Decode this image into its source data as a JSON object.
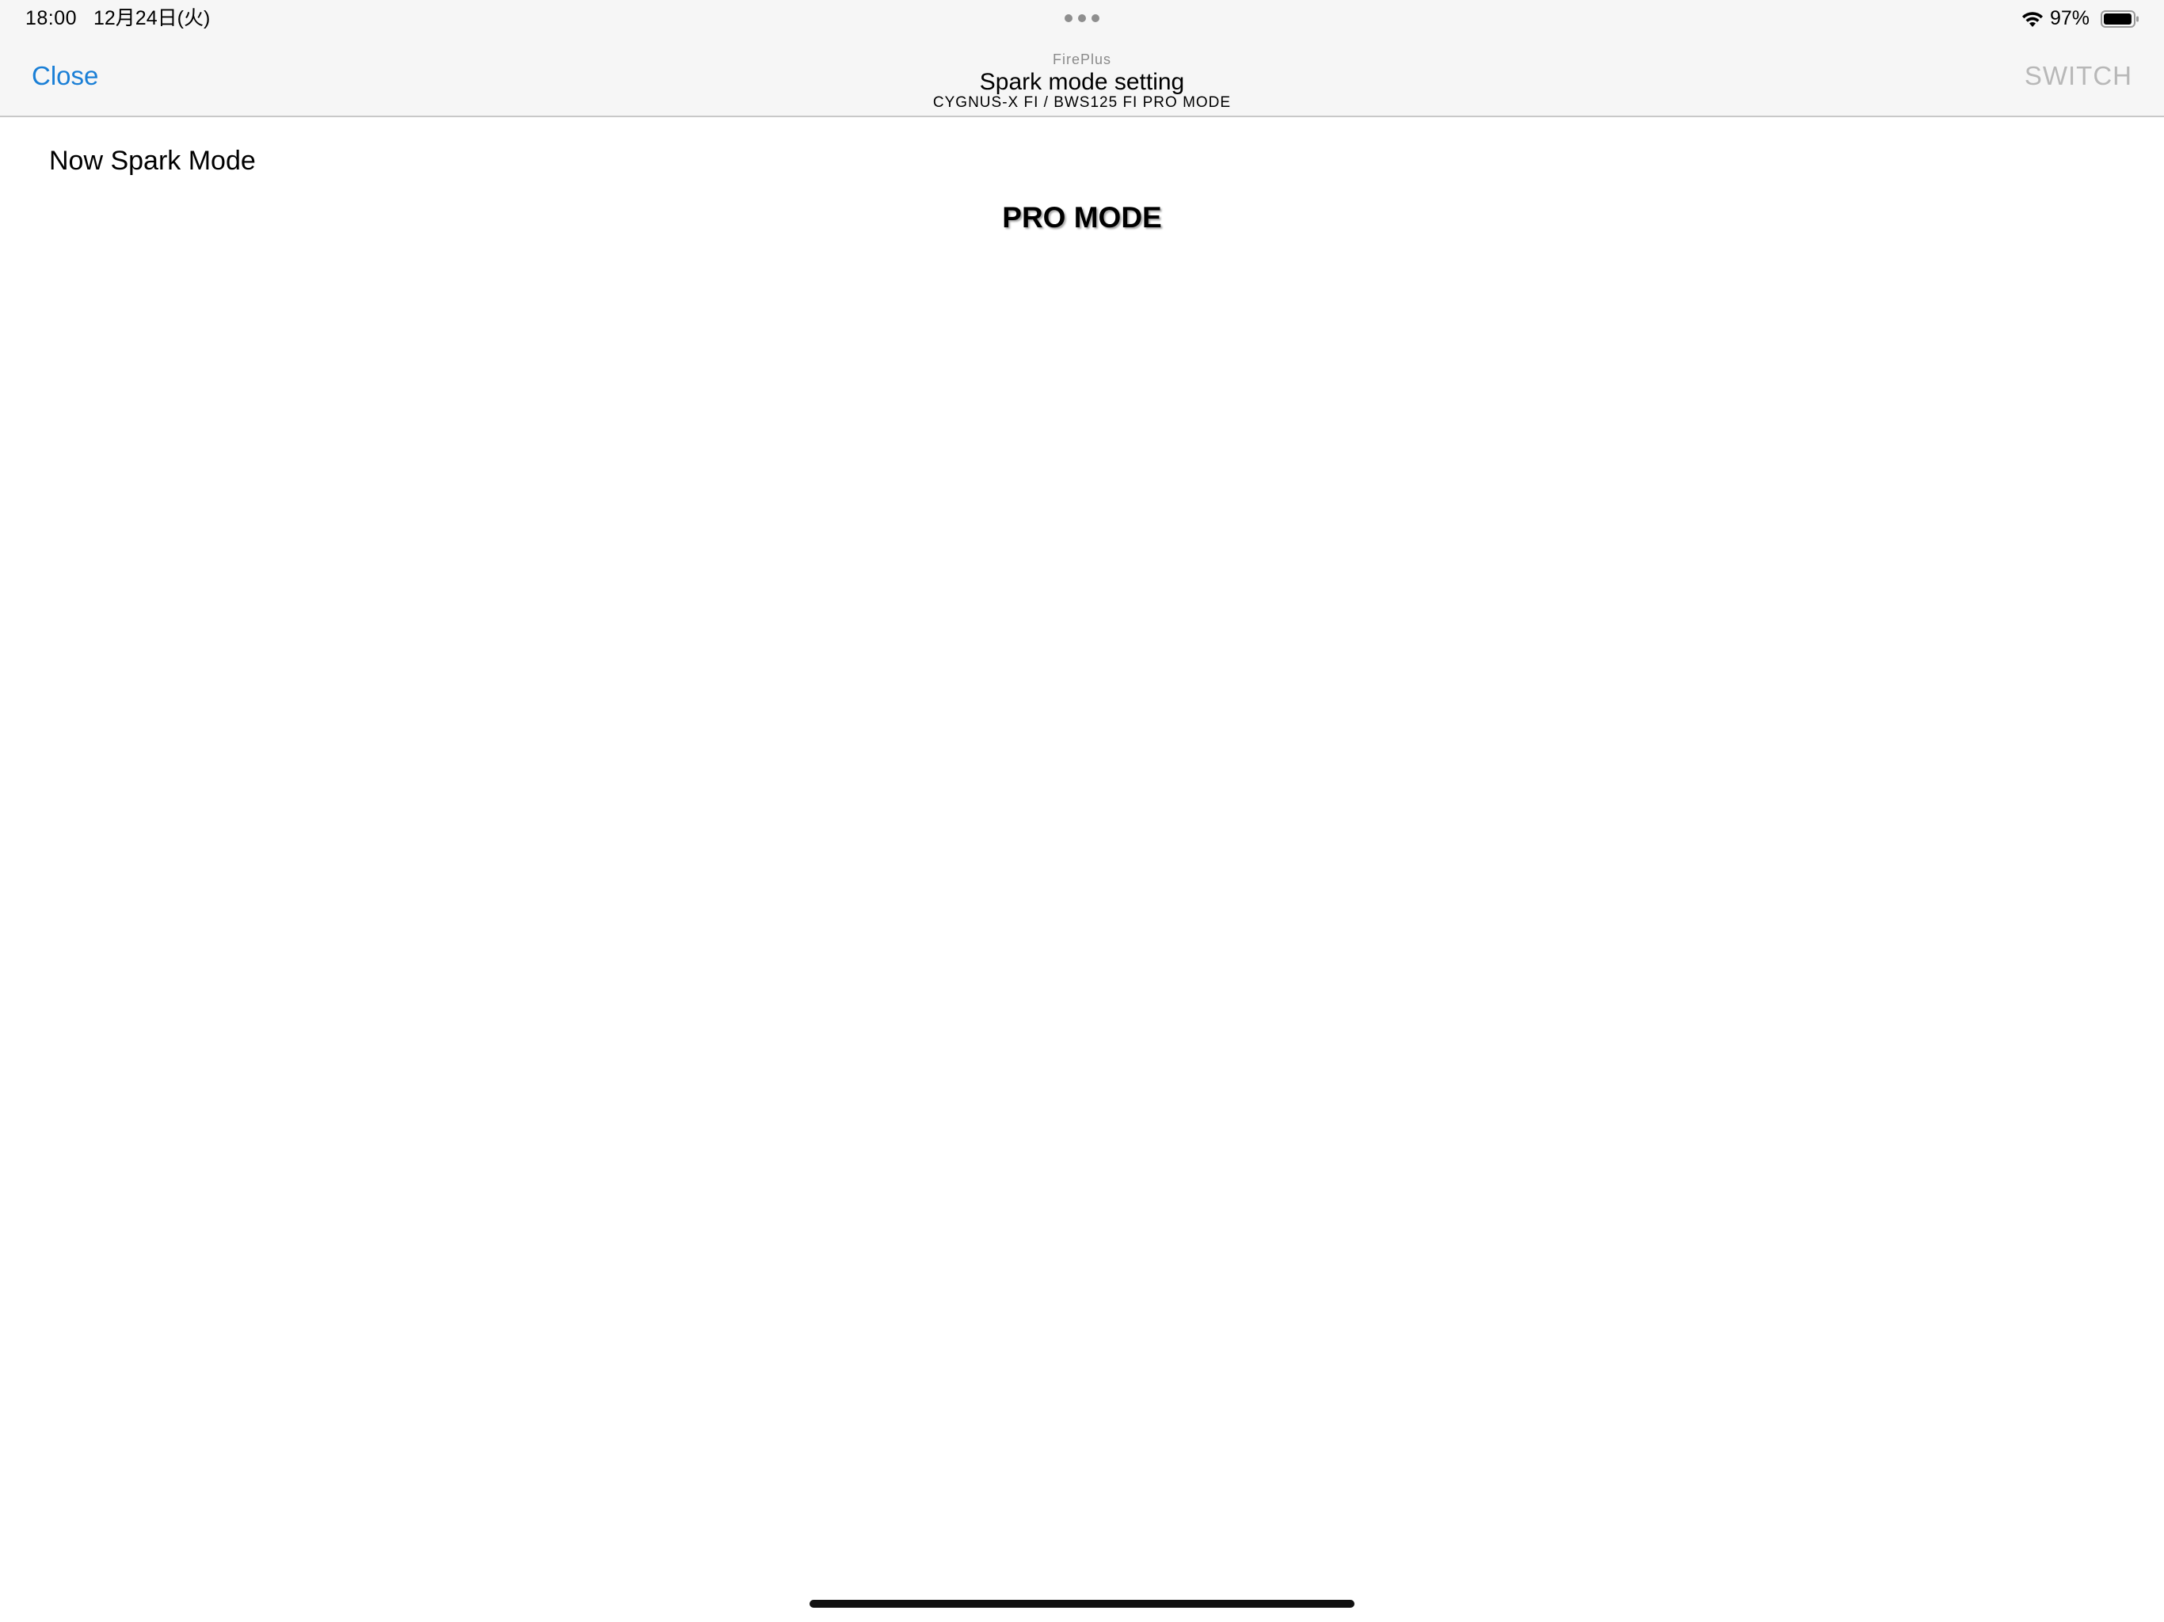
{
  "status_bar": {
    "time": "18:00",
    "date": "12月24日(火)",
    "battery_percent": "97%",
    "battery_level": 0.97
  },
  "nav": {
    "close_label": "Close",
    "app_name": "FirePlus",
    "title": "Spark mode setting",
    "subtitle": "CYGNUS-X FI / BWS125 FI PRO MODE",
    "switch_label": "SWITCH"
  },
  "content": {
    "now_label": "Now Spark Mode",
    "mode_value": "PRO MODE"
  },
  "colors": {
    "accent": "#1a7fd6",
    "disabled": "#b8b8b8",
    "bar_background": "#f6f6f6"
  },
  "icons": [
    "wifi-icon",
    "battery-icon"
  ]
}
